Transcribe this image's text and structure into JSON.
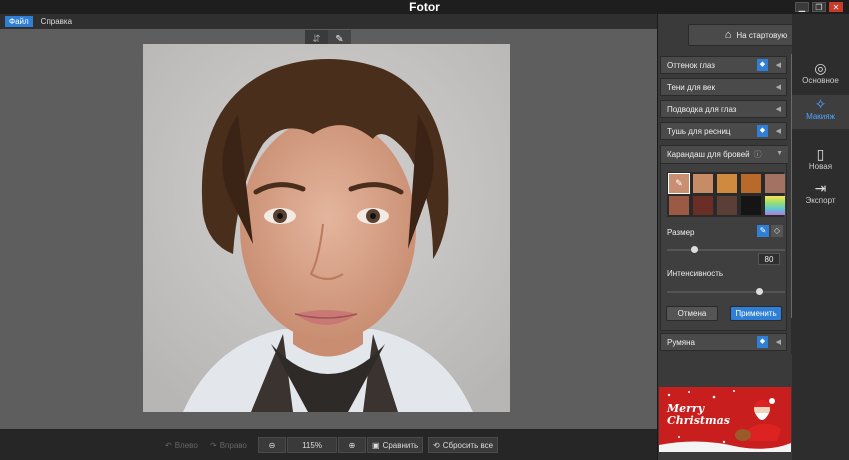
{
  "app": {
    "title": "Fotor"
  },
  "window": {
    "minimize": "▁",
    "restore": "❐",
    "close": "✕"
  },
  "menu": [
    {
      "label": "Файл"
    },
    {
      "label": "Справка"
    }
  ],
  "home_button": {
    "label": "На стартовую"
  },
  "nav": [
    {
      "label": "Основное",
      "icon": "basic-icon"
    },
    {
      "label": "Макияж",
      "icon": "makeup-icon"
    },
    {
      "label": "Новая",
      "icon": "new-icon"
    },
    {
      "label": "Экспорт",
      "icon": "export-icon"
    }
  ],
  "sections": [
    {
      "label": "Оттенок глаз",
      "badge": true
    },
    {
      "label": "Тени для век",
      "badge": false
    },
    {
      "label": "Подводка для глаз",
      "badge": false
    },
    {
      "label": "Тушь для ресниц",
      "badge": true
    }
  ],
  "brow_panel": {
    "title": "Карандаш для бровей",
    "swatches": [
      "#c98f73",
      "#c78c66",
      "#d08a40",
      "#b96a2a",
      "#a47263",
      "#9a5a45",
      "#6a2e26",
      "#5a3e38",
      "#151515",
      "rainbow"
    ],
    "size_label": "Размер",
    "size_value": 0.22,
    "intensity_label": "Интенсивность",
    "intensity_value": "80",
    "cancel_label": "Отмена",
    "apply_label": "Применить"
  },
  "blush_section": {
    "label": "Румяна",
    "badge": true
  },
  "bottom": {
    "undo_label": "Влево",
    "redo_label": "Вправо",
    "zoom_value": "115%",
    "compare_label": "Сравнить",
    "reset_label": "Сбросить все"
  },
  "ad": {
    "text": "Merry Christmas"
  },
  "colors": {
    "accent": "#2f7fd6",
    "panel": "#3a3a3a",
    "canvas": "#5e5e5e"
  }
}
